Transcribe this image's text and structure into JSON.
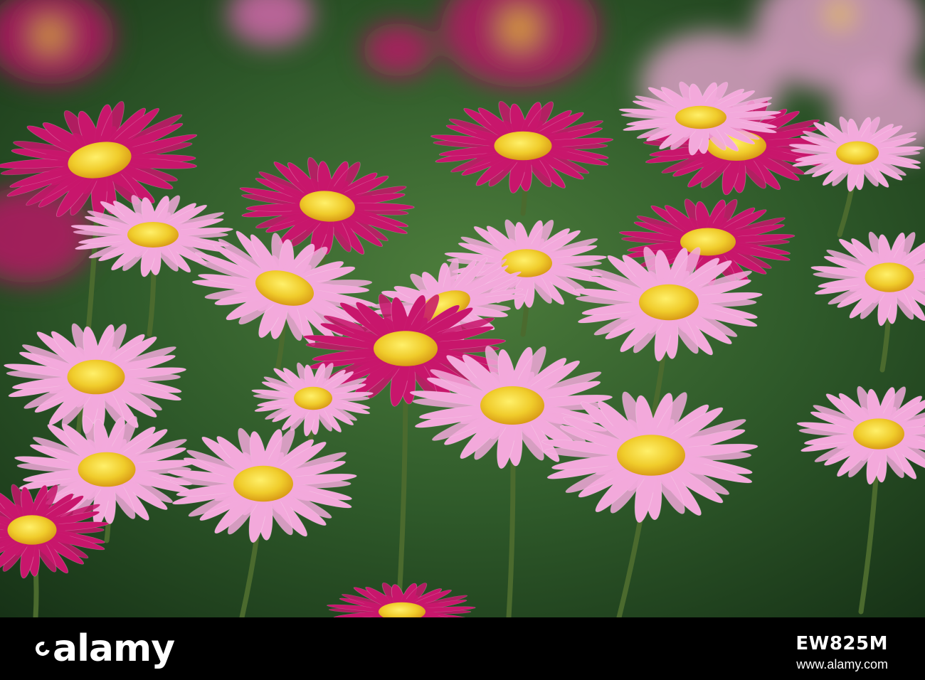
{
  "photo": {
    "subject": "flower-field",
    "colors": {
      "background_dark": "#1f3a1d",
      "background_mid": "#3f6d34",
      "petal_light_pink": "#f3a9db",
      "petal_pink": "#e86bbd",
      "petal_magenta": "#c8166c",
      "center_yellow": "#f0cc2b",
      "center_edge": "#d99b16",
      "stem": "#4b6a2e"
    }
  },
  "watermark": {
    "brand": "alamy",
    "image_id": "EW825M",
    "url": "www.alamy.com"
  }
}
